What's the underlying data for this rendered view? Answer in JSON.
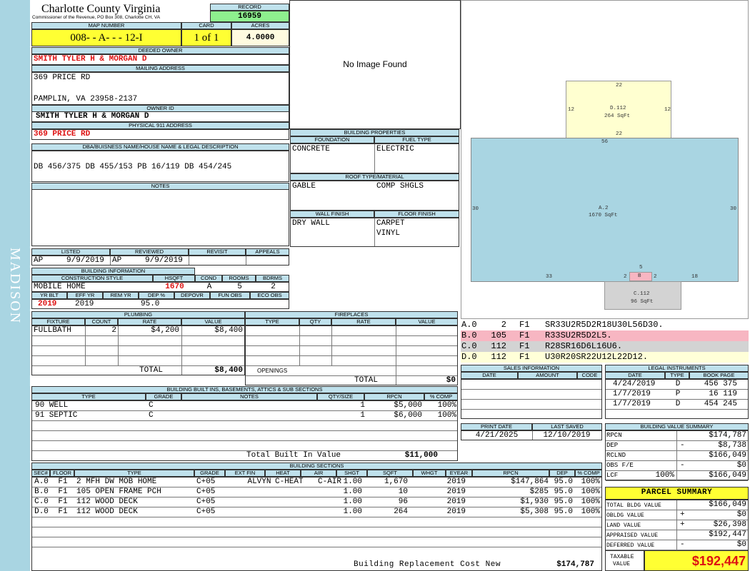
{
  "county": {
    "title": "Charlotte County Virginia",
    "subtitle": "Commissioner of the Revenue, PO Box 308, Charlotte CH, VA"
  },
  "sidebar": {
    "text": "MADISON"
  },
  "record": {
    "label": "RECORD",
    "value": "16959"
  },
  "map": {
    "label": "MAP NUMBER",
    "value": "008- - A- - - 12-I"
  },
  "card": {
    "label": "CARD",
    "value": "1 of 1"
  },
  "acres": {
    "label": "ACRES",
    "value": "4.0000"
  },
  "deeded": {
    "label": "DEEDED OWNER",
    "value": "SMITH TYLER H & MORGAN D"
  },
  "mailing": {
    "label": "MAILING ADDRESS",
    "line1": "369 PRICE RD",
    "line2": "PAMPLIN, VA 23958-2137"
  },
  "owner_id": {
    "label": "OWNER ID",
    "value": "SMITH TYLER H & MORGAN D"
  },
  "physical": {
    "label": "PHYSICAL 911 ADDRESS",
    "value": "369 PRICE RD"
  },
  "dba": {
    "label": "DBA/BUISNESS NAME/HOUSE NAME & LEGAL DESCRIPTION",
    "value": "DB 456/375 DB 455/153 PB 16/119 DB 454/245"
  },
  "notes": {
    "label": "NOTES"
  },
  "image": {
    "text": "No Image Found"
  },
  "dates": {
    "listed_label": "LISTED",
    "listed_code": "AP",
    "listed_date": "9/9/2019",
    "reviewed_label": "REVIEWED",
    "reviewed_code": "AP",
    "reviewed_date": "9/9/2019",
    "revisit_label": "REVISIT",
    "appeals_label": "APPEALS"
  },
  "bldg_info": {
    "label": "BUILDING INFORMATION",
    "h_style": "CONSTRUCTION STYLE",
    "h_hsqft": "HSQFT",
    "h_cond": "COND",
    "h_rooms": "ROOMS",
    "h_bdrms": "BDRMS",
    "style": "MOBILE HOME",
    "hsqft": "1670",
    "cond": "A",
    "rooms": "5",
    "bdrms": "2",
    "h_yrblt": "YR BLT",
    "h_effyr": "EFF YR",
    "h_remyr": "REM YR",
    "h_dep": "DEP %",
    "h_depovr": "DEPOVR",
    "h_funobs": "FUN OBS",
    "h_ecoobs": "ECO OBS",
    "yrblt": "2019",
    "effyr": "2019",
    "dep": "95.0"
  },
  "bldg_props": {
    "label": "BUILDING PROPERTIES",
    "foundation_label": "FOUNDATION",
    "foundation": "CONCRETE",
    "fuel_label": "FUEL TYPE",
    "fuel": "ELECTRIC",
    "roof_label": "ROOF TYPE/MATERIAL",
    "roof1": "GABLE",
    "roof2": "COMP SHGLS",
    "wall_label": "WALL FINISH",
    "wall": "DRY WALL",
    "floor_label": "FLOOR FINISH",
    "floor1": "CARPET",
    "floor2": "VINYL"
  },
  "plumbing": {
    "label": "PLUMBING",
    "h_fixture": "FIXTURE",
    "h_count": "COUNT",
    "h_rate": "RATE",
    "h_value": "VALUE",
    "fixture": "FULLBATH",
    "count": "2",
    "rate": "$4,200",
    "value": "$8,400",
    "total_label": "TOTAL",
    "total": "$8,400"
  },
  "fireplaces": {
    "label": "FIREPLACES",
    "h_type": "TYPE",
    "h_qty": "QTY",
    "h_rate": "RATE",
    "h_value": "VALUE",
    "openings_label": "OPENINGS",
    "total_label": "TOTAL",
    "total": "$0"
  },
  "builtins": {
    "label": "BUILDING BUILT INS, BASEMENTS, ATTICS & SUB SECTIONS",
    "h_type": "TYPE",
    "h_grade": "GRADE",
    "h_notes": "NOTES",
    "h_qty": "QTY/SIZE",
    "h_rpcn": "RPCN",
    "h_comp": "% COMP",
    "rows": [
      {
        "type": "90 WELL",
        "grade": "C",
        "qty": "1",
        "rpcn": "$5,000",
        "comp": "100%"
      },
      {
        "type": "91 SEPTIC",
        "grade": "C",
        "qty": "1",
        "rpcn": "$6,000",
        "comp": "100%"
      }
    ],
    "total_label": "Total Built In Value",
    "total": "$11,000"
  },
  "sections": {
    "label": "BUILDING SECTIONS",
    "h": [
      "SEC#",
      "FLOOR",
      "TYPE",
      "GRADE",
      "EXT FIN",
      "HEAT",
      "AIR",
      "SHGT",
      "SQFT",
      "WHGT",
      "EYEAR",
      "RPCN",
      "DEP",
      "% COMP"
    ],
    "rows": [
      [
        "A.0",
        "F1",
        "2 MFH DW MOB HOME",
        "C+05",
        "ALVYN",
        "C-HEAT",
        "C-AIR",
        "1.00",
        "1,670",
        "",
        "2019",
        "$147,864",
        "95.0",
        "100%"
      ],
      [
        "B.0",
        "F1",
        "105 OPEN FRAME PCH",
        "C+05",
        "",
        "",
        "",
        "1.00",
        "10",
        "",
        "2019",
        "$285",
        "95.0",
        "100%"
      ],
      [
        "C.0",
        "F1",
        "112 WOOD DECK",
        "C+05",
        "",
        "",
        "",
        "1.00",
        "96",
        "",
        "2019",
        "$1,930",
        "95.0",
        "100%"
      ],
      [
        "D.0",
        "F1",
        "112 WOOD DECK",
        "C+05",
        "",
        "",
        "",
        "1.00",
        "264",
        "",
        "2019",
        "$5,308",
        "95.0",
        "100%"
      ]
    ],
    "total_label": "Building Replacement Cost New",
    "total": "$174,787"
  },
  "sketch": {
    "a_title": "A.2",
    "a_area": "1670 SqFt",
    "a_top": "56",
    "a_left": "30",
    "a_right": "30",
    "a_bot1": "33",
    "a_bot2": "18",
    "d_title": "D.112",
    "d_area": "264 SqFt",
    "d_top": "22",
    "d_bot": "22",
    "d_left": "12",
    "d_right": "12",
    "b_title": "B",
    "b_top": "5",
    "b_left": "2",
    "b_right": "2",
    "c_title": "C.112",
    "c_area": "96 SqFt"
  },
  "vectors": [
    {
      "sec": "A.0",
      "code": "2",
      "floor": "F1",
      "vec": "SR33U2R5D2R18U30L56D30.",
      "color": "#ffffff"
    },
    {
      "sec": "B.0",
      "code": "105",
      "floor": "F1",
      "vec": "R33SU2R5D2L5.",
      "color": "#f7b6c2"
    },
    {
      "sec": "C.0",
      "code": "112",
      "floor": "F1",
      "vec": "R28SR16D6L16U6.",
      "color": "#d3d3d3"
    },
    {
      "sec": "D.0",
      "code": "112",
      "floor": "F1",
      "vec": "U30R20SR22U12L22D12.",
      "color": "#ffffd8"
    }
  ],
  "sales": {
    "label": "SALES INFORMATION",
    "h_date": "DATE",
    "h_amount": "AMOUNT",
    "h_code": "CODE"
  },
  "legal": {
    "label": "LEGAL INSTRUMENTS",
    "h_date": "DATE",
    "h_type": "TYPE",
    "h_book": "BOOK PAGE",
    "rows": [
      {
        "date": "4/24/2019",
        "type": "D",
        "book": "456 375"
      },
      {
        "date": "1/7/2019",
        "type": "P",
        "book": "16 119"
      },
      {
        "date": "1/7/2019",
        "type": "D",
        "book": "454 245"
      }
    ]
  },
  "print": {
    "date_label": "PRINT DATE",
    "date": "4/21/2025",
    "saved_label": "LAST SAVED",
    "saved": "12/10/2019"
  },
  "bvs": {
    "label": "BUILDING VALUE SUMMARY",
    "rows": [
      {
        "k": "RPCN",
        "s": "",
        "v": "$174,787"
      },
      {
        "k": "DEP",
        "s": "-",
        "v": "$8,738"
      },
      {
        "k": "RCLND",
        "s": "",
        "v": "$166,049"
      },
      {
        "k": "OBS F/E",
        "s": "-",
        "v": "$0"
      },
      {
        "k": "LCF",
        "p": "100%",
        "s": "",
        "v": "$166,049"
      }
    ]
  },
  "parcel": {
    "label": "PARCEL SUMMARY",
    "rows": [
      {
        "k": "TOTAL BLDG VALUE",
        "s": "",
        "v": "$166,049"
      },
      {
        "k": "OBLDG VALUE",
        "s": "+",
        "v": "$0"
      },
      {
        "k": "LAND VALUE",
        "s": "+",
        "v": "$26,398"
      },
      {
        "k": "APPRAISED VALUE",
        "s": "",
        "v": "$192,447"
      },
      {
        "k": "DEFERRED VALUE",
        "s": "-",
        "v": "$0"
      }
    ],
    "taxable_label1": "TAXABLE",
    "taxable_label2": "VALUE",
    "taxable": "$192,447"
  }
}
